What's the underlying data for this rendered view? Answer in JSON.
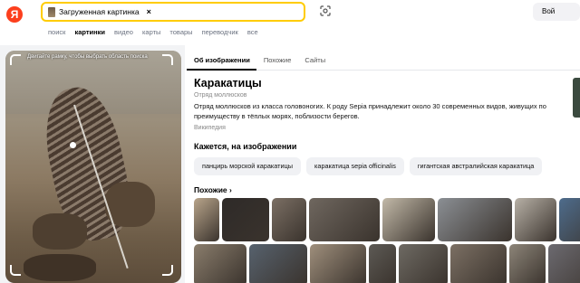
{
  "header": {
    "logo": "Я",
    "search_chip_label": "Загруженная картинка",
    "search_chip_close": "×",
    "login_label": "Вой"
  },
  "tabs": [
    {
      "label": "поиск",
      "active": false
    },
    {
      "label": "картинки",
      "active": true
    },
    {
      "label": "видео",
      "active": false
    },
    {
      "label": "карты",
      "active": false
    },
    {
      "label": "товары",
      "active": false
    },
    {
      "label": "переводчик",
      "active": false
    },
    {
      "label": "все",
      "active": false
    }
  ],
  "image_panel": {
    "crop_hint": "Двигайте рамку, чтобы выбрать область поиска"
  },
  "result_tabs": [
    {
      "label": "Об изображении",
      "active": true
    },
    {
      "label": "Похожие",
      "active": false
    },
    {
      "label": "Сайты",
      "active": false
    }
  ],
  "about": {
    "title": "Каракатицы",
    "subtitle": "Отряд моллюсков",
    "description": "Отряд моллюсков из класса головоногих. К роду Sepia принадлежит около 30 современных видов, живущих по преимуществу в тёплых морях, поблизости берегов.",
    "source": "Википедия"
  },
  "on_image": {
    "heading": "Кажется, на изображении",
    "pills": [
      "панцирь морской каракатицы",
      "каракатица sepia officinalis",
      "гигантская австралийская каракатица"
    ]
  },
  "similar": {
    "heading": "Похожие",
    "chevron": "›",
    "row1_colors": [
      "#b9a58b",
      "#2e2a28",
      "#7b6f64",
      "#6f675f",
      "#c2b9a8",
      "#8b8f94",
      "#b7b0a6",
      "#4e6c8c"
    ],
    "row2_colors": [
      "#8a7d6c",
      "#57626e",
      "#9f8f7c",
      "#5d5a55",
      "#6e6a63",
      "#7c7064",
      "#8d8579",
      "#6c6a70",
      "#98918a"
    ]
  }
}
